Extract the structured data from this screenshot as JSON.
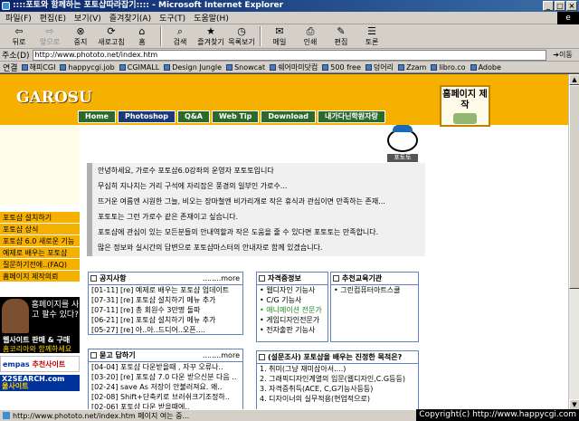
{
  "window": {
    "title": "::::포토와 함께하는 포토샵따라잡기:::: - Microsoft Internet Explorer"
  },
  "menu": [
    "파일(F)",
    "편집(E)",
    "보기(V)",
    "즐겨찾기(A)",
    "도구(T)",
    "도움말(H)"
  ],
  "toolbar": [
    "뒤로",
    "앞으로",
    "중지",
    "새로고침",
    "홈",
    "검색",
    "즐겨찾기",
    "목록보기",
    "메일",
    "인쇄",
    "편집",
    "토론"
  ],
  "address": {
    "label": "주소(D)",
    "url": "http://www.phototo.net/index.htm",
    "go": "이동"
  },
  "links": {
    "label": "연결",
    "items": [
      "해피CGI",
      "happycgi.job",
      "CGIMALL",
      "Design Jungle",
      "Snowcat",
      "쉐어마미닷컴",
      "500 free",
      "덩어리",
      "Zzam",
      "libro.co",
      "Adobe"
    ]
  },
  "site": {
    "logo": "GAROSU",
    "nav": [
      "Home",
      "Photoshop",
      "Q&A",
      "Web Tip",
      "Download",
      "내가다닌학원자랑"
    ],
    "hp_box": "홈페이지 제작",
    "mascot_tag": "포토토",
    "intro": [
      "안녕하세요, 가로수 포토샵6.0강좌의 운영자 포토토입니다",
      "무심히 지나치는 거리 구석에 자리잡은 풍경의 일부인 가로수...",
      "뜨거운 여름엔 시원한 그늘, 비오는 장마철엔 비가리개로 작은 휴식과 관심이면 만족하는 존재...",
      "포토토는 그런 가로수 같은 존재이고 싶습니다.",
      "포토샵에 관심이 있는 모든분들의 안내역할과 작은 도움을 줄 수 있다면 포토토는 만족합니다.",
      "많은 정보와 실시간의 답변으로 포토샵마스터의 안내자로 함께 있겠습니다."
    ],
    "left_menu": [
      "포토샵 설치하기",
      "포토샵 상식",
      "포토샵 6.0 새로운 기능",
      "예제로 배우는 포토샵",
      "질문하기전에..(FAQ)",
      "홈페이지 제작의뢰"
    ],
    "ad1": {
      "line1": "홈페이지를 사고 팔수 있다?",
      "line2": "웹사이트 판매 & 구매",
      "line3": "홈코리아와 함께하세요"
    },
    "ad2": {
      "brand": "empas",
      "text": "추천사이트"
    },
    "ad3": {
      "brand": "X2SEARCH.com",
      "text": "울사이트"
    },
    "notice": {
      "title": "공지사항",
      "more": "........more",
      "rows": [
        "[01-11] [re] 예제로 배우는 포토샵 업데이트",
        "[07-31] [re] 포토샵 설치하기 메뉴 추가",
        "[07-11] [re] 총 회원수 3만명 돌파",
        "[06-21] [re] 포토샵 설치하기 메뉴 추가",
        "[05-27] [re] 아..아..드디어..오픈...."
      ]
    },
    "qna": {
      "title": "묻고 답하기",
      "more": "........more",
      "rows": [
        "[04-04] 포토샵 다운받을때 , 자꾸 오류나..",
        "[03-20] [re] 포토샵 7.0 다운 받으신분 다음 ..",
        "[02-24] save As 저장이 안불러져요. 왜..",
        "[02-08] Shift+단축키로 브러쉬크기조정하..",
        "[02-06] 포토샵 다운 받을때에.."
      ]
    },
    "cert": {
      "title": "자격증정보",
      "rows": [
        "웹디자인 기능사",
        "C/G 기능사",
        "애니메이션 전문가",
        "게임디자인전문가",
        "전자출판 기능사"
      ]
    },
    "edu": {
      "title": "추천교육기관",
      "rows": [
        "그린컴퓨터아트스쿨"
      ]
    },
    "survey": {
      "title": "(설문조사) 포토샵을 배우는 진정한 목적은?",
      "rows": [
        "1. 취미(그냥 재미삼아서....)",
        "2. 그래픽디자인계열의 입문(웹디자인,C.G등등)",
        "3. 자격증취득(ACE, C,G기능사등등)",
        "4. 디자이너의 실무적용(현업적으로)"
      ]
    }
  },
  "status": {
    "text": "http://www.phototo.net/index.htm 페이지 여는 중...",
    "copyright": "Copyright(c) http://www.happycgi.com"
  }
}
